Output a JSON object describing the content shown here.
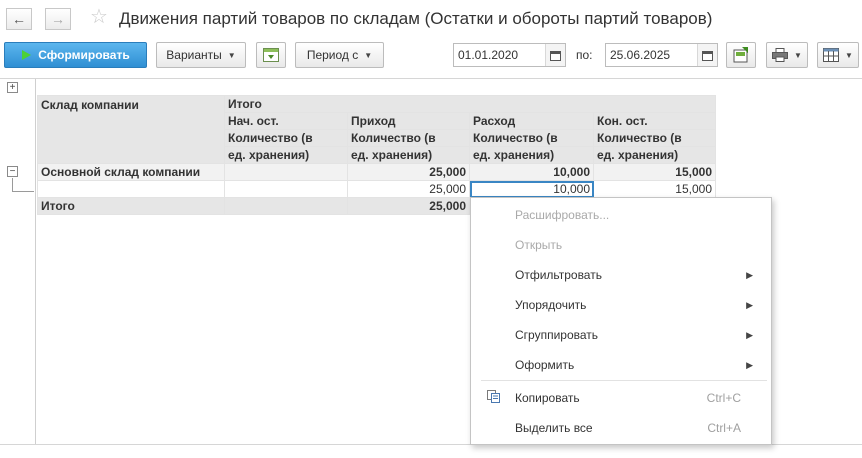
{
  "window": {
    "title": "Движения партий товаров по складам (Остатки и обороты партий товаров)",
    "back_icon": "←",
    "forward_icon": "→",
    "favorite_icon": "☆"
  },
  "toolbar": {
    "generate_label": "Сформировать",
    "variants_label": "Варианты",
    "period_label": "Период с",
    "date_from": "01.01.2020",
    "to_label": "по:",
    "date_to": "25.06.2025"
  },
  "report": {
    "headers": {
      "warehouse": "Склад компании",
      "total_group": "Итого",
      "start_balance": "Нач. ост.",
      "receipt": "Приход",
      "expense": "Расход",
      "end_balance": "Кон. ост.",
      "qty_line1": "Количество (в",
      "qty_line2": "ед. хранения)"
    },
    "rows": [
      {
        "name": "Основной склад компании",
        "start": "",
        "receipt": "25,000",
        "expense": "10,000",
        "end": "15,000"
      },
      {
        "name": "",
        "start": "",
        "receipt": "25,000",
        "expense": "10,000",
        "end": "15,000"
      },
      {
        "name": "Итого",
        "start": "",
        "receipt": "25,000",
        "expense": "",
        "end": ""
      }
    ]
  },
  "context_menu": {
    "items": [
      {
        "label": "Расшифровать...",
        "disabled": true
      },
      {
        "label": "Открыть",
        "disabled": true
      },
      {
        "label": "Отфильтровать",
        "submenu": true
      },
      {
        "label": "Упорядочить",
        "submenu": true
      },
      {
        "label": "Сгруппировать",
        "submenu": true
      },
      {
        "label": "Оформить",
        "submenu": true
      },
      {
        "label": "Копировать",
        "shortcut": "Ctrl+C"
      },
      {
        "label": "Выделить все",
        "shortcut": "Ctrl+A"
      }
    ]
  },
  "colors": {
    "primary": "#2f8fd3",
    "header_bg": "#e6e6e6",
    "selection": "#3a86c4"
  }
}
